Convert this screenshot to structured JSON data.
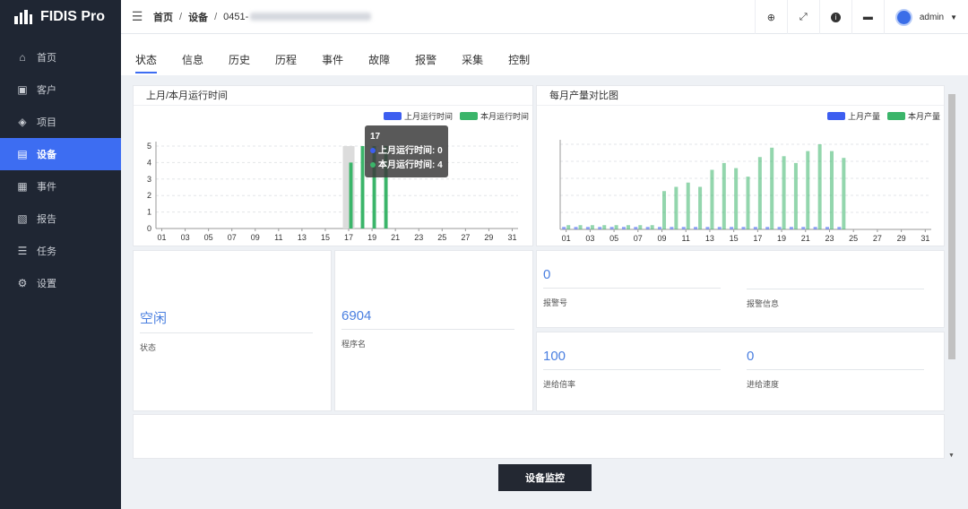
{
  "brand": {
    "name": "FIDIS Pro"
  },
  "nav": [
    {
      "label": "首页",
      "icon": "home-icon",
      "glyph": "⌂",
      "active": false
    },
    {
      "label": "客户",
      "icon": "customer-icon",
      "glyph": "▣",
      "active": false
    },
    {
      "label": "项目",
      "icon": "layers-icon",
      "glyph": "◈",
      "active": false
    },
    {
      "label": "设备",
      "icon": "device-icon",
      "glyph": "▤",
      "active": true
    },
    {
      "label": "事件",
      "icon": "event-icon",
      "glyph": "▦",
      "active": false
    },
    {
      "label": "报告",
      "icon": "report-icon",
      "glyph": "▧",
      "active": false
    },
    {
      "label": "任务",
      "icon": "task-icon",
      "glyph": "☰",
      "active": false
    },
    {
      "label": "设置",
      "icon": "settings-icon",
      "glyph": "⚙",
      "active": false
    }
  ],
  "breadcrumb": {
    "home": "首页",
    "section": "设备",
    "current": "0451-"
  },
  "header": {
    "user": "admin"
  },
  "tabs": [
    "状态",
    "信息",
    "历史",
    "历程",
    "事件",
    "故障",
    "报警",
    "采集",
    "控制"
  ],
  "runtime_panel": {
    "title": "上月/本月运行时间",
    "legend_prev": "上月运行时间",
    "legend_curr": "本月运行时间",
    "tooltip_day": "17",
    "tooltip_prev": "上月运行时间: 0",
    "tooltip_curr": "本月运行时间: 4"
  },
  "output_panel": {
    "title": "每月产量对比图",
    "legend_prev": "上月产量",
    "legend_curr": "本月产量"
  },
  "colors": {
    "prev": "#3d5ef0",
    "curr": "#3bb56a",
    "accent": "#3d6df2"
  },
  "chart_data": [
    {
      "type": "bar",
      "title": "上月/本月运行时间",
      "x_ticks": [
        "01",
        "03",
        "05",
        "07",
        "09",
        "11",
        "13",
        "15",
        "17",
        "19",
        "21",
        "23",
        "25",
        "27",
        "29",
        "31"
      ],
      "y_ticks": [
        "0",
        "1",
        "2",
        "3",
        "4",
        "5"
      ],
      "ylim": [
        0,
        5
      ],
      "days": 31,
      "series": [
        {
          "name": "上月运行时间",
          "values": [
            0,
            0,
            0,
            0,
            0,
            0,
            0,
            0,
            0,
            0,
            0,
            0,
            0,
            0,
            0,
            0,
            0,
            0,
            0,
            0,
            0,
            0,
            0,
            0,
            0,
            0,
            0,
            0,
            0,
            0,
            0
          ]
        },
        {
          "name": "本月运行时间",
          "values": [
            0,
            0,
            0,
            0,
            0,
            0,
            0,
            0,
            0,
            0,
            0,
            0,
            0,
            0,
            0,
            0,
            4,
            5,
            5,
            5,
            0,
            0,
            0,
            0,
            0,
            0,
            0,
            0,
            0,
            0,
            0
          ]
        }
      ],
      "highlight_day": 17
    },
    {
      "type": "bar",
      "title": "每月产量对比图",
      "x_ticks": [
        "01",
        "03",
        "05",
        "07",
        "09",
        "11",
        "13",
        "15",
        "17",
        "19",
        "21",
        "23",
        "25",
        "27",
        "29",
        "31"
      ],
      "ylim": [
        0,
        100
      ],
      "days": 31,
      "series": [
        {
          "name": "上月产量",
          "values": [
            3,
            3,
            3,
            3,
            3,
            3,
            3,
            3,
            3,
            3,
            3,
            3,
            3,
            3,
            3,
            3,
            3,
            3,
            3,
            3,
            3,
            3,
            3,
            3,
            0,
            0,
            0,
            0,
            0,
            0,
            0
          ]
        },
        {
          "name": "本月产量",
          "values": [
            5,
            5,
            5,
            5,
            5,
            5,
            5,
            5,
            45,
            50,
            55,
            50,
            70,
            78,
            72,
            62,
            85,
            96,
            86,
            78,
            92,
            100,
            92,
            84,
            0,
            0,
            0,
            0,
            0,
            0,
            0
          ]
        }
      ]
    }
  ],
  "cards": {
    "status_value": "空闲",
    "status_label": "状态",
    "program_value": "6904",
    "program_label": "程序名",
    "alarm_no_value": "0",
    "alarm_no_label": "报警号",
    "alarm_info_label": "报警信息",
    "feed_rate_value": "100",
    "feed_rate_label": "进给倍率",
    "feed_speed_value": "0",
    "feed_speed_label": "进给速度"
  },
  "monitor_button": "设备监控"
}
